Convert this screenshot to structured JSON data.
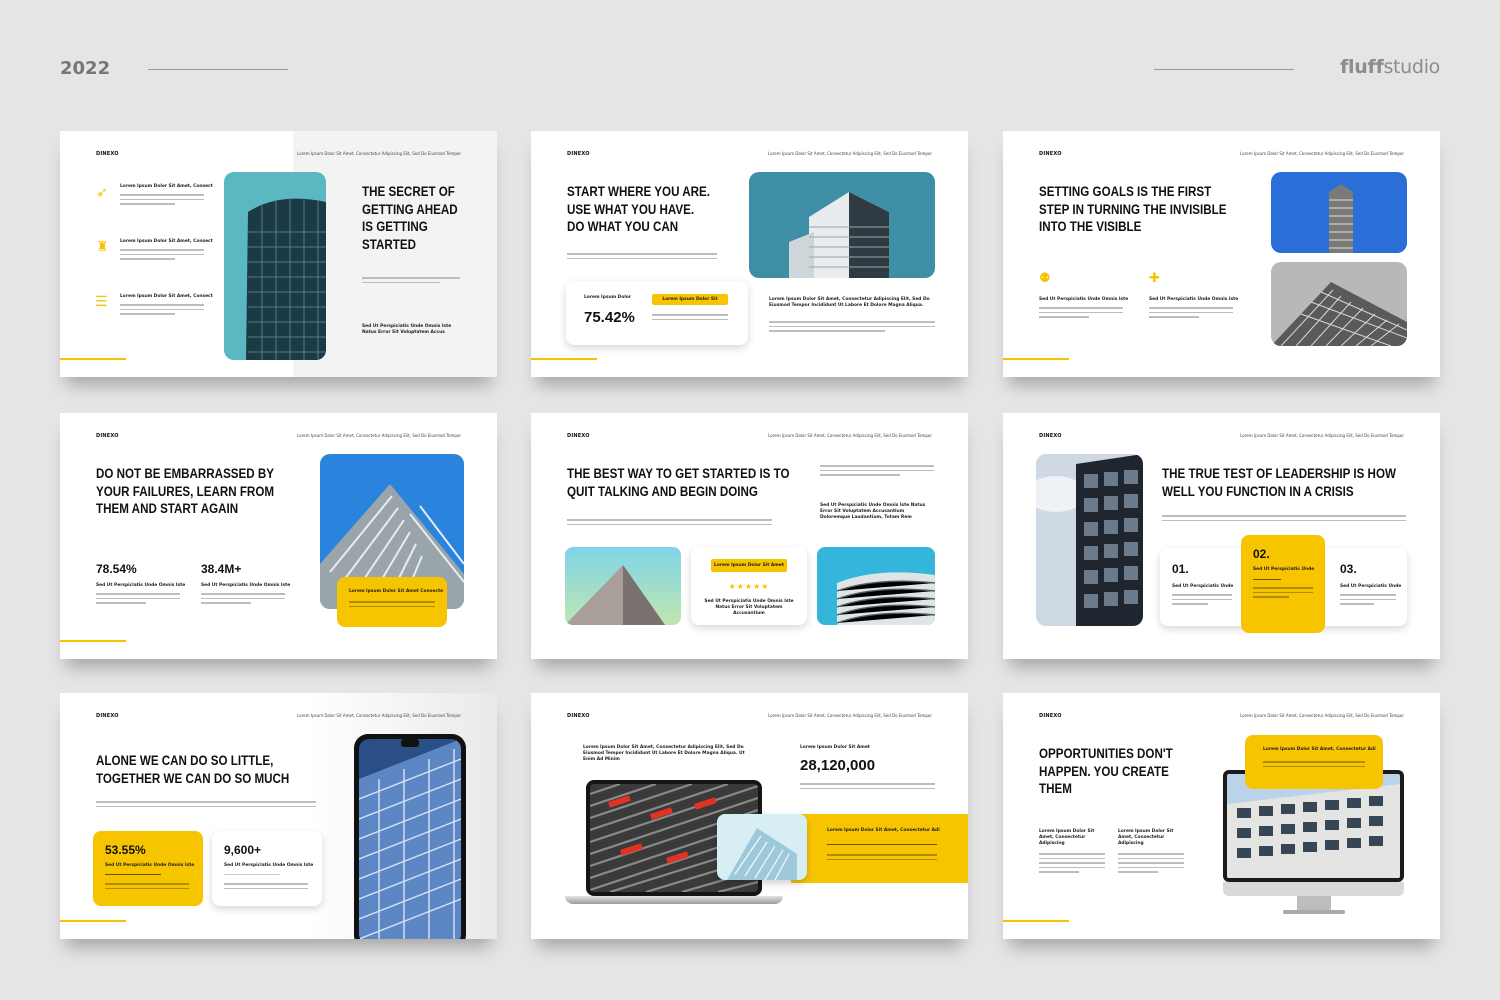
{
  "header": {
    "year": "2022",
    "brand_bold": "fluff",
    "brand_light": "studio"
  },
  "common": {
    "logo": "DINEXO",
    "topnote": "Lorem Ipsum Dolor Sit Amet, Consectetur Adipiscing Elit, Sed Do Eiusmod Tempor"
  },
  "s1": {
    "title": "THE SECRET OF\nGETTING AHEAD\nIS GETTING\nSTARTED",
    "items": [
      "Lorem Ipsum Dolor Sit Amet, Consect",
      "Lorem Ipsum Dolor Sit Amet, Consect",
      "Lorem Ipsum Dolor Sit Amet, Consect"
    ],
    "note": "Sed Ut Perspiciatis Unde Omnis Iste Natus Error Sit Voluptatem Accus"
  },
  "s2": {
    "title": "START WHERE YOU ARE.\nUSE WHAT YOU HAVE.\nDO WHAT YOU CAN",
    "card_label": "Lorem Ipsum Dolor",
    "stat": "75.42%",
    "tag": "Lorem Ipsum Dolor Sit",
    "desc": "Lorem Ipsum Dolor Sit Amet, Consectetur Adipiscing Elit, Sed Do Eiusmod Tempor Incididunt Ut Labore Et Dolore Magna Aliqua."
  },
  "s3": {
    "title": "SETTING GOALS IS THE FIRST\nSTEP IN TURNING THE INVISIBLE\nINTO THE VISIBLE",
    "col1": "Sed Ut Perspiciatis Unde Omnis Iste",
    "col2": "Sed Ut Perspiciatis Unde Omnis Iste"
  },
  "s4": {
    "title": "DO NOT BE EMBARRASSED BY\nYOUR FAILURES, LEARN FROM\nTHEM AND START AGAIN",
    "stat1": "78.54%",
    "stat1_label": "Sed Ut Perspiciatis Unde Omnis Iste",
    "stat2": "38.4M+",
    "stat2_label": "Sed Ut Perspiciatis Unde Omnis Iste",
    "card": "Lorem Ipsum Dolor Sit Amet Consecte"
  },
  "s5": {
    "title": "THE BEST WAY TO GET STARTED IS TO\nQUIT TALKING AND BEGIN DOING",
    "note": "Sed Ut Perspiciatis Unde Omnis Iste Natus Error Sit Voluptatem Accusantium Doloremque Laudantium, Totam Rem",
    "tag": "Lorem Ipsum Dolor Sit Amet",
    "stars": "★★★★★",
    "card_note": "Sed Ut Perspiciatis Unde Omnis Iste Natus Error Sit Voluptatem Accusantium"
  },
  "s6": {
    "title": "THE TRUE TEST OF LEADERSHIP IS HOW\nWELL YOU FUNCTION IN A CRISIS",
    "steps": [
      {
        "num": "01.",
        "label": "Sed Ut Perspiciatis Unde"
      },
      {
        "num": "02.",
        "label": "Sed Ut Perspiciatis Unde"
      },
      {
        "num": "03.",
        "label": "Sed Ut Perspiciatis Unde"
      }
    ]
  },
  "s7": {
    "title": "ALONE WE CAN DO SO LITTLE,\nTOGETHER WE CAN DO SO MUCH",
    "stat1": "53.55%",
    "stat1_label": "Sed Ut Perspiciatis Unde Omnis Iste",
    "stat2": "9,600+",
    "stat2_label": "Sed Ut Perspiciatis Unde Omnis Iste"
  },
  "s8": {
    "head": "Lorem Ipsum Dolor Sit Amet, Consectetur Adipiscing Elit, Sed Do Eiusmod Tempor Incididunt Ut Labore Et Dolore Magna Aliqua. Ut Enim Ad Minim",
    "label": "Lorem Ipsum Dolor Sit Amet",
    "stat": "28,120,000",
    "band": "Lorem Ipsum Dolor Sit Amet, Consectetur Adi"
  },
  "s9": {
    "title": "OPPORTUNITIES DON'T\nHAPPEN. YOU CREATE\nTHEM",
    "col1": "Lorem Ipsum Dolor Sit Amet, Consectetur Adipiscing",
    "col2": "Lorem Ipsum Dolor Sit Amet, Consectetur Adipiscing",
    "card": "Lorem Ipsum Dolor Sit Amet, Consectetur Adi"
  },
  "colors": {
    "accent": "#f7c500",
    "text": "#111111",
    "bg": "#e5e5e5"
  }
}
